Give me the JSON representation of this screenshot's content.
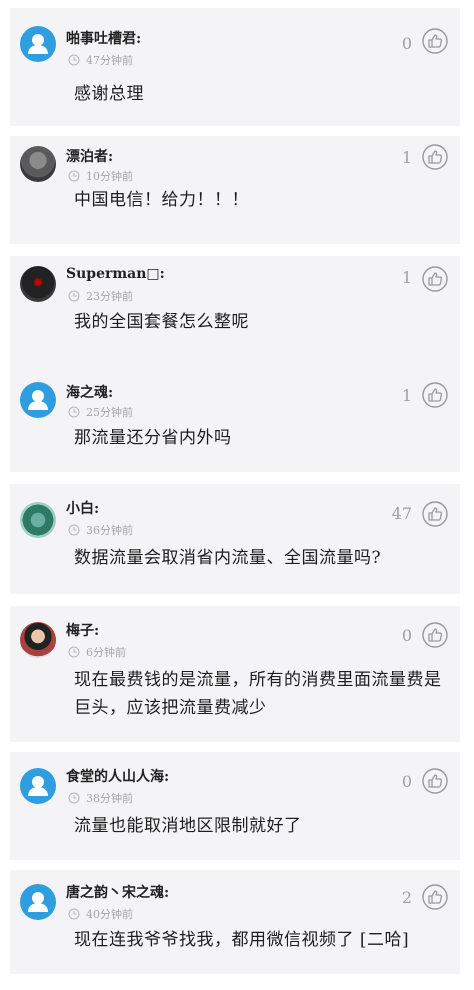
{
  "comments": [
    {
      "name": "啪事吐槽君:",
      "time": "47分钟前",
      "likes": "0",
      "text": "感谢总理",
      "avatar": "default-avatar"
    },
    {
      "name": "漂泊者:",
      "time": "10分钟前",
      "likes": "1",
      "text": "中国电信！给力！！！",
      "avatar": "photo-avatar"
    },
    {
      "name": "Superman□:",
      "time": "23分钟前",
      "likes": "1",
      "text": "我的全国套餐怎么整呢",
      "avatar": "photo-avatar"
    },
    {
      "name": "海之魂:",
      "time": "25分钟前",
      "likes": "1",
      "text": "那流量还分省内外吗",
      "avatar": "default-avatar"
    },
    {
      "name": "小白:",
      "time": "36分钟前",
      "likes": "47",
      "text": "数据流量会取消省内流量、全国流量吗?",
      "avatar": "photo-avatar"
    },
    {
      "name": "梅子:",
      "time": "6分钟前",
      "likes": "0",
      "text": "现在最费钱的是流量，所有的消费里面流量费是巨头，应该把流量费减少",
      "avatar": "photo-avatar"
    },
    {
      "name": "食堂的人山人海:",
      "time": "38分钟前",
      "likes": "0",
      "text": "流量也能取消地区限制就好了",
      "avatar": "default-avatar"
    },
    {
      "name": "唐之韵丶宋之魂:",
      "time": "40分钟前",
      "likes": "2",
      "text": "现在连我爷爷找我，都用微信视频了 [二哈]",
      "avatar": "default-avatar"
    }
  ],
  "colors": {
    "card_bg": "#f4f4f6",
    "avatar_blue": "#2e9ee0",
    "meta_gray": "#a6a6a6"
  },
  "icons": {
    "like": "thumbs-up-icon",
    "time": "clock-icon",
    "avatar": "person-icon"
  }
}
